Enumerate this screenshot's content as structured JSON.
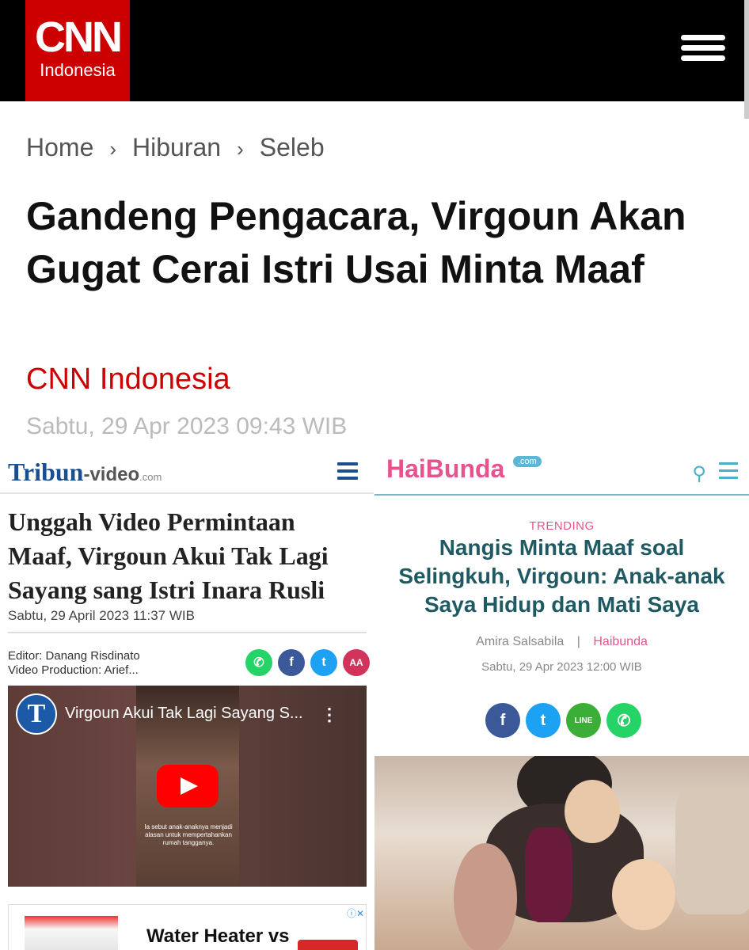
{
  "cnn": {
    "logo_main": "CNN",
    "logo_sub": "Indonesia",
    "breadcrumb": [
      "Home",
      "Hiburan",
      "Seleb"
    ],
    "breadcrumb_sep": "›",
    "headline": "Gandeng Pengacara, Virgoun Akan Gugat Cerai Istri Usai Minta Maaf",
    "source": "CNN Indonesia",
    "date": "Sabtu, 29 Apr 2023 09:43 WIB"
  },
  "tribun": {
    "logo_main": "Tribun",
    "logo_dash": "-video",
    "logo_com": ".com",
    "title": "Unggah Video Permintaan Maaf, Virgoun Akui Tak Lagi Sayang sang Istri Inara Rusli",
    "date": "Sabtu, 29 April 2023 11:37 WIB",
    "editor": "Editor: Danang Risdinato",
    "production": "Video Production: Arief...",
    "share_labels": [
      "✆",
      "f",
      "t",
      "AA"
    ],
    "share_colors": [
      "#25d366",
      "#3b5998",
      "#1da1f2",
      "#d1335a"
    ],
    "video": {
      "channel_letter": "T",
      "title": "Virgoun Akui Tak Lagi Sayang S...",
      "menu": "⋮",
      "caption": "Ia sebut anak-anaknya menjadi alasan untuk mempertahankan rumah tangganya."
    },
    "ad": {
      "text": "Water Heater vs",
      "icons": "ⓘ✕"
    }
  },
  "haibunda": {
    "logo": "HaiBunda",
    "logo_com": ".com",
    "search_icon": "⚲",
    "trending": "TRENDING",
    "title": "Nangis Minta Maaf soal Selingkuh, Virgoun: Anak-anak Saya Hidup dan Mati Saya",
    "author": "Amira Salsabila",
    "separator": "|",
    "brand": "Haibunda",
    "date": "Sabtu, 29 Apr 2023 12:00 WIB",
    "share_labels": [
      "f",
      "t",
      "LINE",
      "✆"
    ],
    "share_colors": [
      "#3b5998",
      "#1da1f2",
      "#3aae36",
      "#25d366"
    ]
  }
}
